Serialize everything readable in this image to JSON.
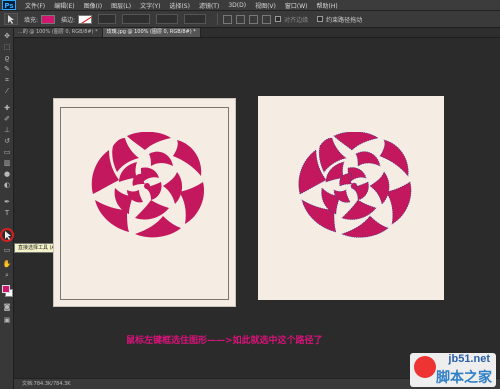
{
  "app": {
    "logo": "Ps"
  },
  "menu": [
    "文件(F)",
    "编辑(E)",
    "图像(I)",
    "图层(L)",
    "文字(Y)",
    "选择(S)",
    "滤镜(T)",
    "3D(D)",
    "视图(V)",
    "窗口(W)",
    "帮助(H)"
  ],
  "options": {
    "fill_label": "填充:",
    "stroke_label": "描边:",
    "align_edges_label": "对齐边缘",
    "constrain_label": "约束路径拖动",
    "fill_color": "#d01770"
  },
  "tabs": [
    {
      "label": "...的 @ 100% (图层 0, RGB/8#) *",
      "active": false
    },
    {
      "label": "玫瑰.jpg @ 100% (图层 0, RGB/8#) *",
      "active": true
    }
  ],
  "toolbar": {
    "tooltip": "直接选择工具 (A)",
    "icons": [
      "move-icon",
      "marquee-icon",
      "lasso-icon",
      "quick-select-icon",
      "crop-icon",
      "eyedropper-icon",
      "healing-icon",
      "brush-icon",
      "stamp-icon",
      "history-brush-icon",
      "eraser-icon",
      "gradient-icon",
      "blur-icon",
      "dodge-icon",
      "pen-icon",
      "type-icon",
      "direct-select-icon",
      "shape-icon",
      "hand-icon",
      "zoom-icon"
    ],
    "foreground_color": "#d01770",
    "background_color": "#ffffff"
  },
  "canvas": {
    "background_color": "#f5ede4",
    "rose_color": "#c4185e"
  },
  "instruction": "鼠标左键框选住图形——>如此就选中这个路径了",
  "status": {
    "doc_info": "文档:784.3K/784.3K"
  },
  "watermark": {
    "url": "jb51.net",
    "text": "脚本之家"
  }
}
